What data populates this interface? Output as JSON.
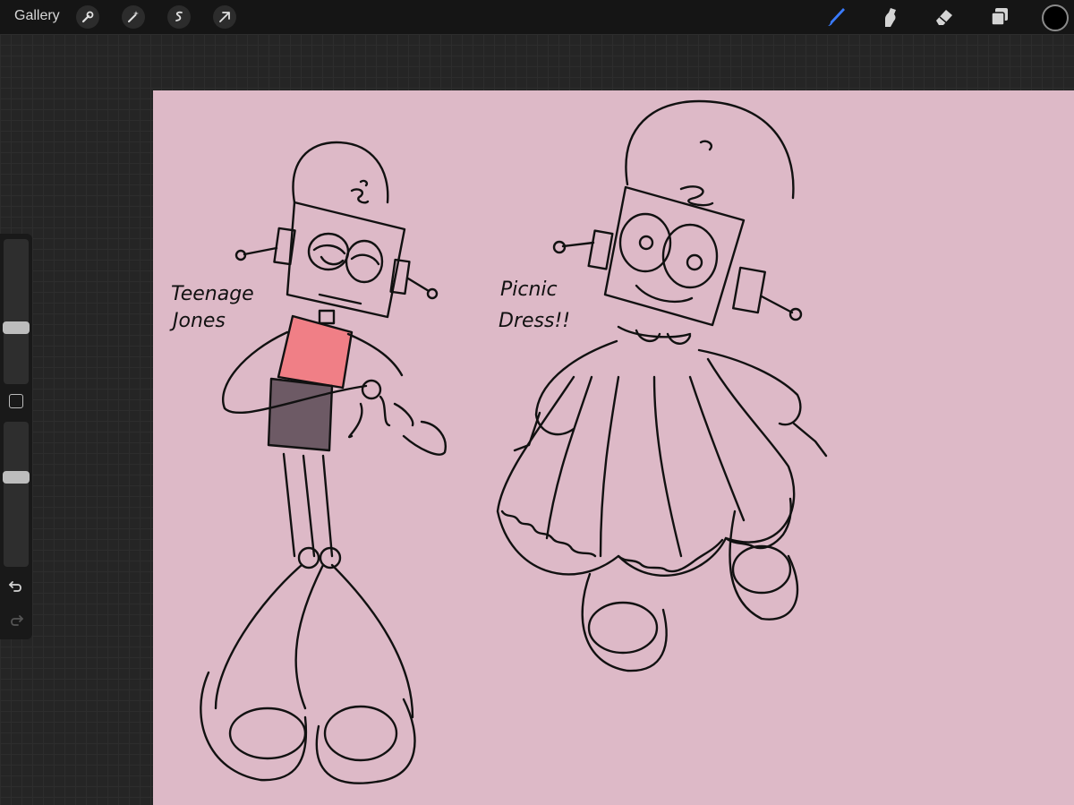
{
  "toolbar": {
    "gallery_label": "Gallery",
    "left_tools": [
      "wrench-icon",
      "magic-wand-icon",
      "selection-s-icon",
      "transform-arrow-icon"
    ],
    "right_tools": [
      "brush-icon",
      "smudge-icon",
      "eraser-icon",
      "layers-icon"
    ],
    "active_tool": "brush",
    "active_color": "#000000",
    "brush_accent_color": "#3a7bff"
  },
  "sidebar": {
    "brush_size": 0.38,
    "brush_opacity": 0.63,
    "modify_label": "",
    "undo_icon": "undo-icon",
    "redo_icon": "redo-icon"
  },
  "canvas": {
    "background_color": "#ddb9c7",
    "labels": {
      "left_line1": "Teenage",
      "left_line2": "Jones",
      "right_line1": "Picnic",
      "right_line2": "Dress!!"
    },
    "shirt_color": "#f07f86",
    "pants_color": "#6d5a65"
  }
}
